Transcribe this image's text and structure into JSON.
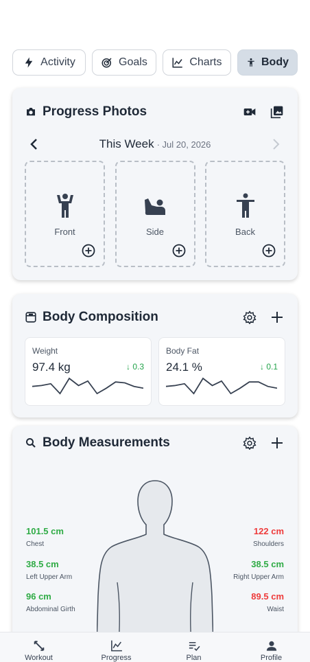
{
  "tabs": [
    {
      "label": "Activity",
      "icon": "bolt-icon",
      "active": false
    },
    {
      "label": "Goals",
      "icon": "target-icon",
      "active": false
    },
    {
      "label": "Charts",
      "icon": "line-chart-icon",
      "active": false
    },
    {
      "label": "Body",
      "icon": "person-icon",
      "active": true
    }
  ],
  "progress_photos": {
    "title": "Progress Photos",
    "week_label": "This Week",
    "week_date": "· Jul 20, 2026",
    "slots": [
      {
        "label": "Front"
      },
      {
        "label": "Side"
      },
      {
        "label": "Back"
      }
    ]
  },
  "body_composition": {
    "title": "Body Composition",
    "metrics": [
      {
        "name": "Weight",
        "value": "97.4 kg",
        "delta": "0.3",
        "trend": [
          0.55,
          0.6,
          0.7,
          0.15,
          1.0,
          0.6,
          0.85,
          0.15,
          0.45,
          0.8,
          0.75,
          0.55,
          0.45
        ]
      },
      {
        "name": "Body Fat",
        "value": "24.1 %",
        "delta": "0.1",
        "trend": [
          0.55,
          0.6,
          0.7,
          0.15,
          1.0,
          0.6,
          0.85,
          0.15,
          0.45,
          0.8,
          0.8,
          0.55,
          0.45
        ]
      }
    ]
  },
  "body_measurements": {
    "title": "Body Measurements",
    "left": [
      {
        "value": "101.5 cm",
        "label": "Chest",
        "status": "green"
      },
      {
        "value": "38.5 cm",
        "label": "Left Upper Arm",
        "status": "green"
      },
      {
        "value": "96 cm",
        "label": "Abdominal Girth",
        "status": "green"
      }
    ],
    "right": [
      {
        "value": "122 cm",
        "label": "Shoulders",
        "status": "red"
      },
      {
        "value": "38.5 cm",
        "label": "Right Upper Arm",
        "status": "green"
      },
      {
        "value": "89.5 cm",
        "label": "Waist",
        "status": "red"
      }
    ]
  },
  "bottom_nav": [
    {
      "label": "Workout",
      "icon": "dumbbell-icon"
    },
    {
      "label": "Progress",
      "icon": "chart-icon"
    },
    {
      "label": "Plan",
      "icon": "checklist-icon"
    },
    {
      "label": "Profile",
      "icon": "person-icon"
    }
  ],
  "colors": {
    "green": "#2fab45",
    "red": "#ee3b3b",
    "accent": "#d5dde6"
  }
}
